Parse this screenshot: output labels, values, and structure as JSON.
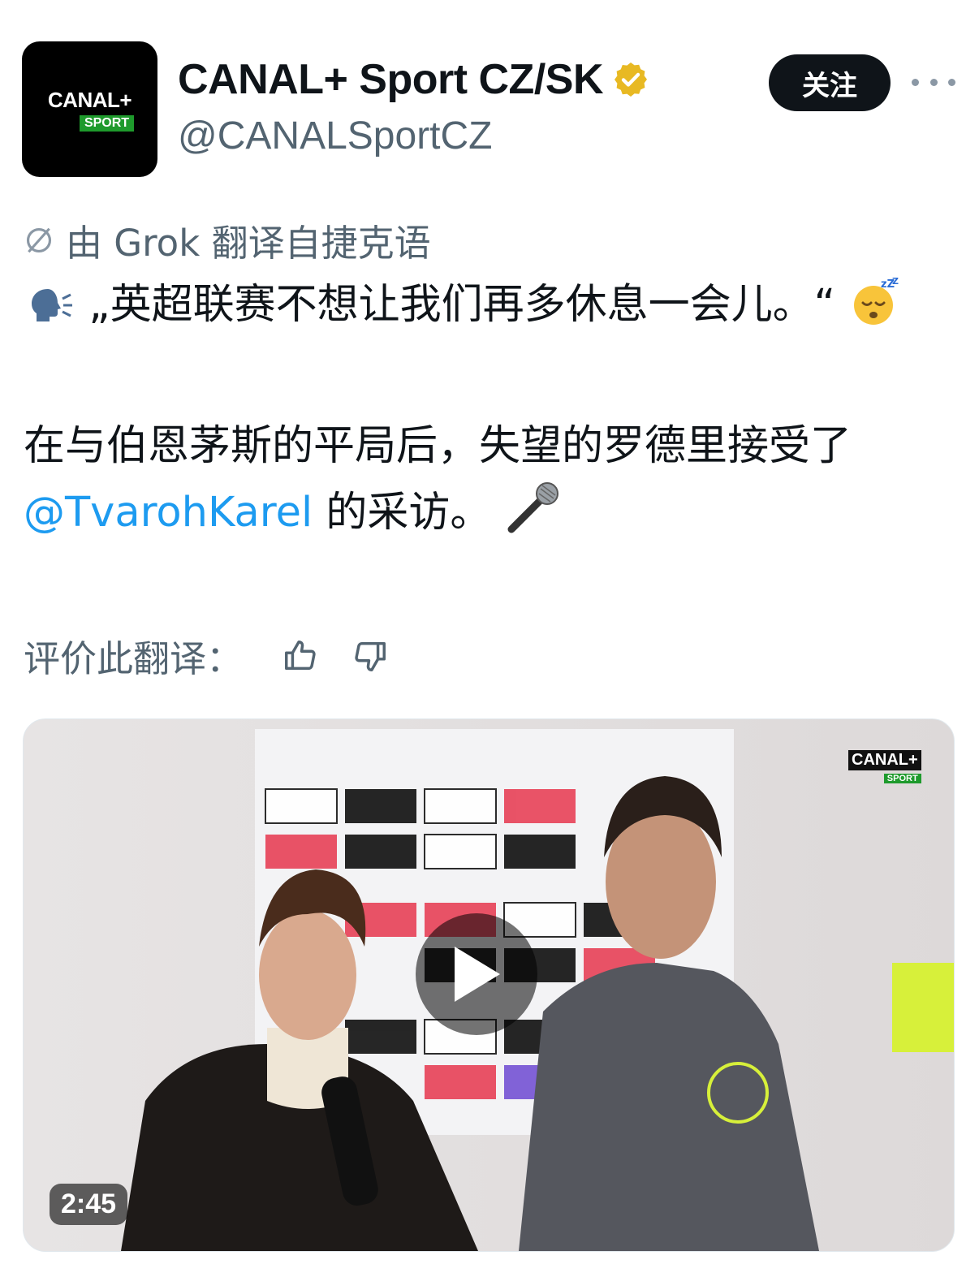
{
  "account": {
    "avatar_brand": "CANAL+",
    "avatar_sub": "SPORT",
    "display_name": "CANAL+ Sport CZ/SK",
    "handle": "@CANALSportCZ",
    "verified_color": "#e8b923"
  },
  "actions": {
    "follow_label": "关注"
  },
  "translation": {
    "note": "由 Grok 翻译自捷克语"
  },
  "tweet": {
    "line1_text": "„英超联赛不想让我们再多休息一会儿。“",
    "line2_prefix": "在与伯恩茅斯的平局后，失望的罗德里接受了 ",
    "mention": "@TvarohKarel",
    "line2_suffix": " 的采访。"
  },
  "rating": {
    "label": "评价此翻译："
  },
  "video": {
    "duration": "2:45",
    "watermark_brand": "CANAL+",
    "watermark_sub": "SPORT"
  },
  "colors": {
    "link": "#1d9bf0",
    "muted": "#536471",
    "text": "#0f1419"
  }
}
